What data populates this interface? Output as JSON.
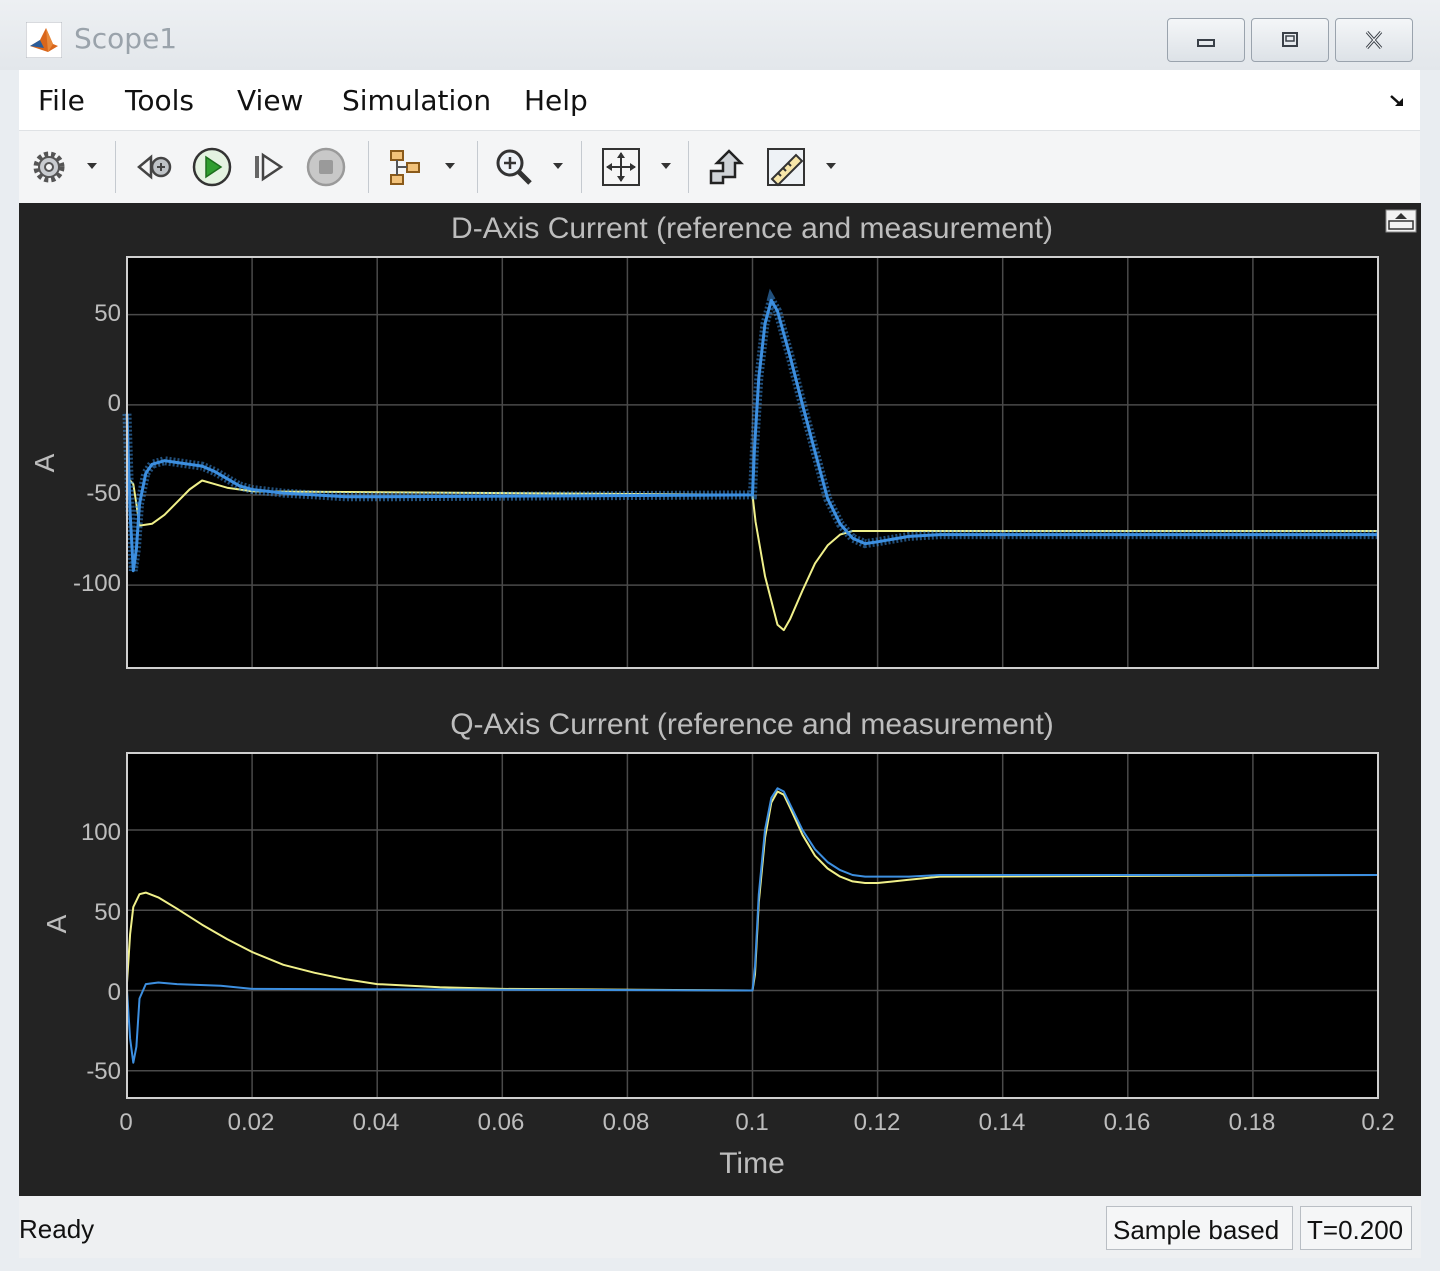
{
  "window": {
    "title": "Scope1",
    "buttons": [
      "minimize",
      "restore",
      "close"
    ]
  },
  "menu": {
    "items": [
      "File",
      "Tools",
      "View",
      "Simulation",
      "Help"
    ]
  },
  "toolbar": {
    "icons": [
      "settings-icon",
      "step-back-icon",
      "run-icon",
      "step-forward-icon",
      "stop-icon",
      "signal-select-icon",
      "zoom-in-icon",
      "autoscale-icon",
      "highlight-block-icon",
      "measure-icon"
    ]
  },
  "status": {
    "text": "Ready",
    "mode": "Sample based",
    "time": "T=0.200"
  },
  "colors": {
    "reference": "#f0f08a",
    "measurement": "#3d8fe0",
    "axes_bg": "#000000",
    "figure_bg": "#232323",
    "grid": "#4a4a4a",
    "text": "#bdbdbd"
  },
  "chart_data": [
    {
      "type": "line",
      "title": "D-Axis Current (reference and measurement)",
      "xlabel": "",
      "ylabel": "A",
      "xlim": [
        0,
        0.2
      ],
      "ylim": [
        -146,
        82
      ],
      "yticks": [
        "50",
        "0",
        "-50",
        "-100"
      ],
      "ytick_values": [
        50,
        0,
        -50,
        -100
      ],
      "grid": true,
      "series": [
        {
          "color": "yellow",
          "x": [
            0,
            0.0005,
            0.001,
            0.0015,
            0.002,
            0.004,
            0.006,
            0.008,
            0.01,
            0.012,
            0.014,
            0.016,
            0.02,
            0.1,
            0.1005,
            0.102,
            0.104,
            0.105,
            0.106,
            0.108,
            0.11,
            0.112,
            0.114,
            0.116,
            0.118,
            0.12,
            0.125,
            0.2
          ],
          "y": [
            -48,
            -42,
            -44,
            -55,
            -67,
            -66,
            -61,
            -54,
            -47,
            -42,
            -44,
            -46,
            -48,
            -50,
            -65,
            -95,
            -122,
            -125,
            -119,
            -103,
            -88,
            -78,
            -72,
            -70,
            -70,
            -70,
            -70,
            -70
          ]
        },
        {
          "color": "blue",
          "x": [
            0,
            0.0005,
            0.001,
            0.0015,
            0.002,
            0.003,
            0.004,
            0.006,
            0.008,
            0.01,
            0.012,
            0.014,
            0.016,
            0.018,
            0.02,
            0.025,
            0.03,
            0.035,
            0.04,
            0.1,
            0.1003,
            0.101,
            0.102,
            0.103,
            0.104,
            0.106,
            0.108,
            0.11,
            0.112,
            0.114,
            0.116,
            0.118,
            0.12,
            0.125,
            0.13,
            0.2
          ],
          "y": [
            -5,
            -60,
            -92,
            -80,
            -55,
            -38,
            -33,
            -31,
            -32,
            -33,
            -34,
            -37,
            -41,
            -45,
            -47,
            -49,
            -50,
            -51,
            -51,
            -50,
            -25,
            15,
            45,
            58,
            52,
            27,
            0,
            -26,
            -52,
            -66,
            -74,
            -77,
            -76,
            -73,
            -72,
            -72
          ]
        }
      ]
    },
    {
      "type": "line",
      "title": "Q-Axis Current (reference and measurement)",
      "xlabel": "Time",
      "ylabel": "A",
      "xlim": [
        0,
        0.2
      ],
      "ylim": [
        -67,
        148
      ],
      "xticks": [
        "0",
        "0.02",
        "0.04",
        "0.06",
        "0.08",
        "0.1",
        "0.12",
        "0.14",
        "0.16",
        "0.18",
        "0.2"
      ],
      "xtick_values": [
        0,
        0.02,
        0.04,
        0.06,
        0.08,
        0.1,
        0.12,
        0.14,
        0.16,
        0.18,
        0.2
      ],
      "yticks": [
        "100",
        "50",
        "0",
        "-50"
      ],
      "ytick_values": [
        100,
        50,
        0,
        -50
      ],
      "grid": true,
      "series": [
        {
          "color": "yellow",
          "x": [
            0,
            0.0005,
            0.001,
            0.002,
            0.003,
            0.005,
            0.008,
            0.012,
            0.016,
            0.02,
            0.025,
            0.03,
            0.035,
            0.04,
            0.05,
            0.06,
            0.1,
            0.1004,
            0.101,
            0.102,
            0.103,
            0.104,
            0.105,
            0.106,
            0.108,
            0.11,
            0.112,
            0.114,
            0.116,
            0.118,
            0.12,
            0.125,
            0.13,
            0.2
          ],
          "y": [
            5,
            35,
            52,
            60,
            61,
            58,
            51,
            41,
            32,
            24,
            16,
            11,
            7,
            4,
            2,
            1,
            0,
            10,
            55,
            95,
            117,
            124,
            122,
            114,
            97,
            84,
            76,
            71,
            68,
            67,
            67,
            69,
            71,
            72
          ]
        },
        {
          "color": "blue",
          "x": [
            0,
            0.0005,
            0.001,
            0.0015,
            0.002,
            0.003,
            0.005,
            0.008,
            0.015,
            0.02,
            0.1,
            0.1004,
            0.101,
            0.102,
            0.103,
            0.104,
            0.105,
            0.106,
            0.108,
            0.11,
            0.112,
            0.114,
            0.116,
            0.118,
            0.12,
            0.125,
            0.13,
            0.2
          ],
          "y": [
            0,
            -30,
            -45,
            -35,
            -5,
            4,
            5,
            4,
            3,
            1,
            0,
            15,
            60,
            100,
            120,
            126,
            124,
            116,
            100,
            88,
            80,
            75,
            72,
            71,
            71,
            71,
            72,
            72
          ]
        }
      ]
    }
  ]
}
